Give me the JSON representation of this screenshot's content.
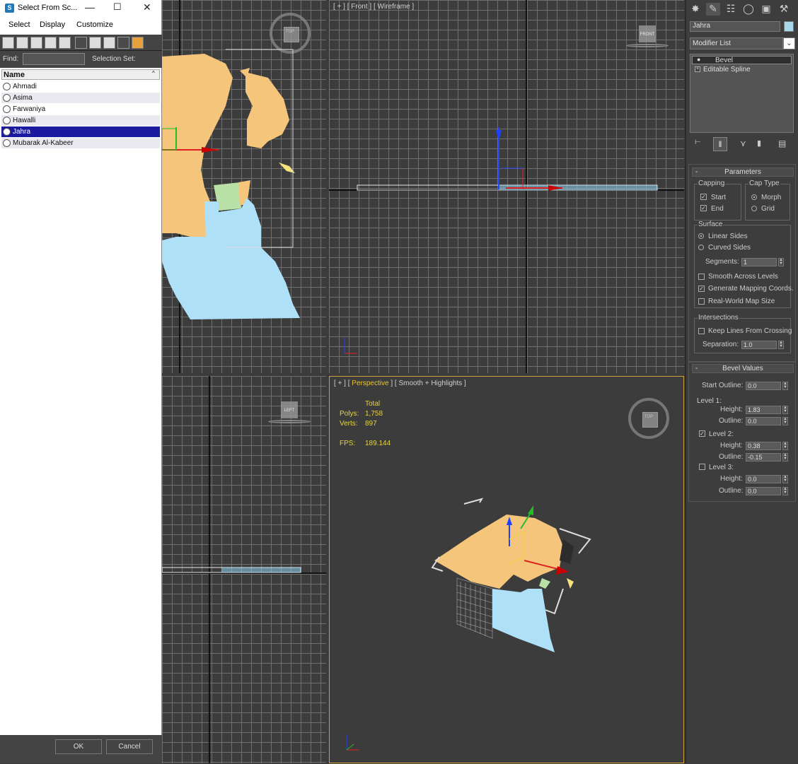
{
  "dialog": {
    "title": "Select From Sc...",
    "menu": [
      "Select",
      "Display",
      "Customize"
    ],
    "find_label": "Find:",
    "selection_set_label": "Selection Set:",
    "list_header": "Name",
    "items": [
      "Ahmadi",
      "Asima",
      "Farwaniya",
      "Hawalli",
      "Jahra",
      "Mubarak Al-Kabeer"
    ],
    "selected_item": "Jahra",
    "ok_label": "OK",
    "cancel_label": "Cancel"
  },
  "viewports": {
    "front": {
      "label_prefix": "[ + ] [ Front ] [ ",
      "label_mode": "Wireframe",
      "label_suffix": " ]",
      "cube_label": "FRONT"
    },
    "top": {
      "cube_label": "TOP"
    },
    "left": {
      "cube_label": "LEFT"
    },
    "perspective": {
      "label_prefix": "[ + ] [ ",
      "label_view": "Perspective",
      "label_mid": " ] [ ",
      "label_mode": "Smooth + Highlights",
      "label_suffix": " ]",
      "cube_label": "TOP",
      "stats": {
        "total_label": "Total",
        "polys_label": "Polys:",
        "polys": "1,758",
        "verts_label": "Verts:",
        "verts": "897",
        "fps_label": "FPS:",
        "fps": "189.144"
      }
    }
  },
  "command_panel": {
    "object_name": "Jahra",
    "object_color": "#a6d8ea",
    "modifier_list": "Modifier List",
    "stack": [
      {
        "label": "Bevel",
        "active": true
      },
      {
        "label": "Editable Spline",
        "active": false
      }
    ],
    "parameters": {
      "title": "Parameters",
      "capping": {
        "title": "Capping",
        "start": "Start",
        "end": "End",
        "start_checked": true,
        "end_checked": true
      },
      "cap_type": {
        "title": "Cap Type",
        "morph": "Morph",
        "grid": "Grid",
        "selected": "Morph"
      },
      "surface": {
        "title": "Surface",
        "linear": "Linear Sides",
        "curved": "Curved Sides",
        "segments_label": "Segments:",
        "segments": "1",
        "smooth_across": "Smooth Across Levels",
        "gen_mapping": "Generate Mapping Coords.",
        "real_world": "Real-World Map Size"
      },
      "intersections": {
        "title": "Intersections",
        "keep_lines": "Keep Lines From Crossing",
        "separation_label": "Separation:",
        "separation": "1.0"
      }
    },
    "bevel_values": {
      "title": "Bevel Values",
      "start_outline_label": "Start Outline:",
      "start_outline": "0.0",
      "level1_label": "Level 1:",
      "level2_label": "Level 2:",
      "level3_label": "Level 3:",
      "height_label": "Height:",
      "outline_label": "Outline:",
      "l1_height": "1.83",
      "l1_outline": "0.0",
      "l2_height": "0.38",
      "l2_outline": "-0.15",
      "l3_height": "0.0",
      "l3_outline": "0.0"
    }
  }
}
